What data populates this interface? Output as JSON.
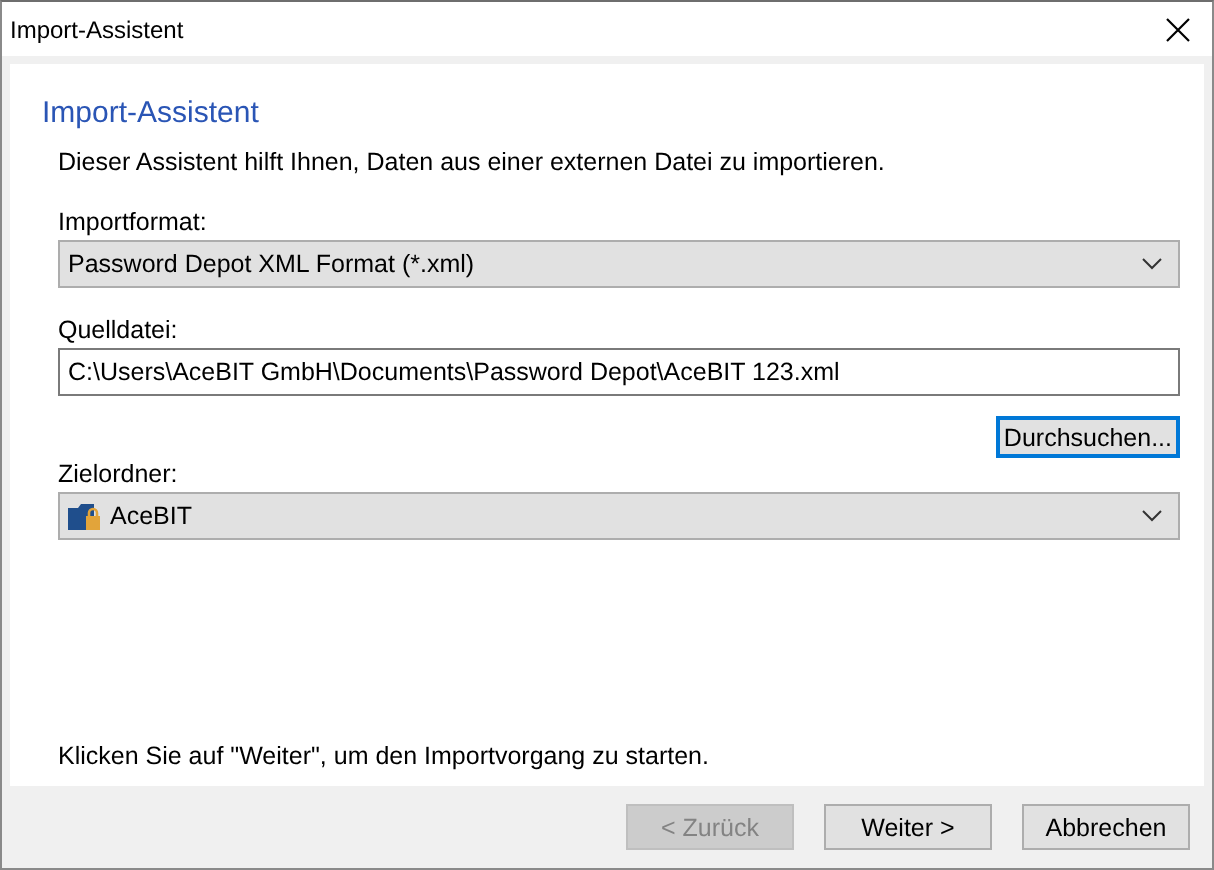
{
  "window": {
    "title": "Import-Assistent"
  },
  "heading": "Import-Assistent",
  "intro": "Dieser Assistent hilft Ihnen, Daten aus einer externen Datei zu importieren.",
  "import_format": {
    "label": "Importformat:",
    "value": "Password Depot XML Format (*.xml)"
  },
  "source_file": {
    "label": "Quelldatei:",
    "value": "C:\\Users\\AceBIT GmbH\\Documents\\Password Depot\\AceBIT 123.xml"
  },
  "browse_button": {
    "label": "Durchsuchen...",
    "focused": true
  },
  "target_folder": {
    "label": "Zielordner:",
    "value": "AceBIT"
  },
  "hint": "Klicken Sie auf \"Weiter\", um den Importvorgang zu starten.",
  "buttons": [
    {
      "label": "< Zurück",
      "disabled": true
    },
    {
      "label": "Weiter >",
      "disabled": false
    },
    {
      "label": "Abbrechen",
      "disabled": false
    }
  ]
}
